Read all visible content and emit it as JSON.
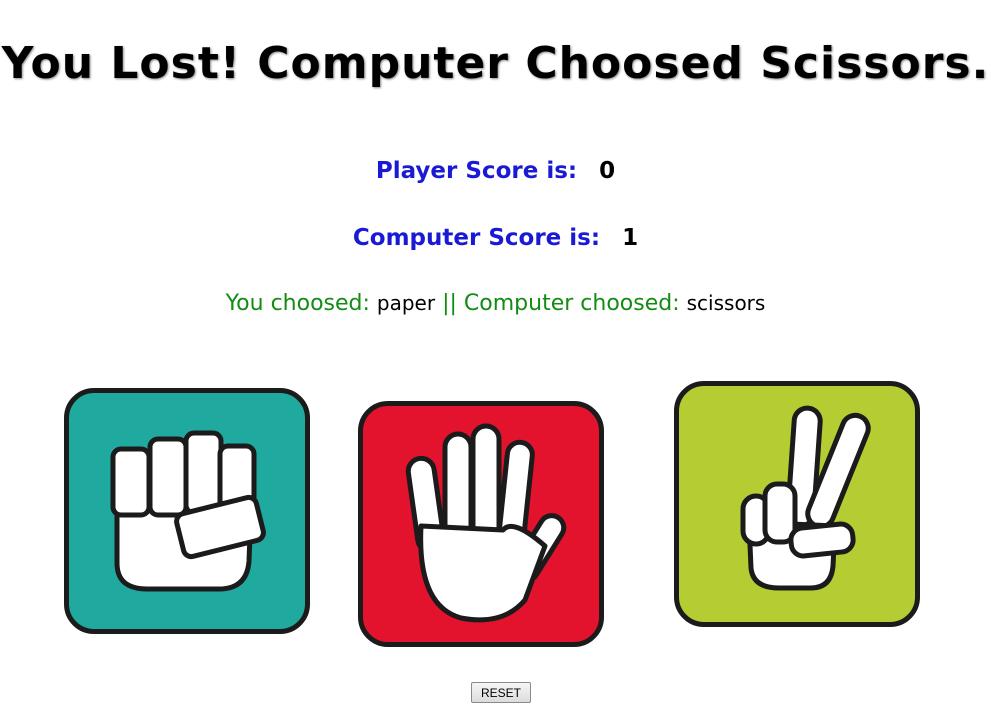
{
  "title": "You Lost! Computer Choosed Scissors.",
  "player_score": {
    "label": "Player Score is:",
    "value": "0"
  },
  "computer_score": {
    "label": "Computer Score is:",
    "value": "1"
  },
  "choices": {
    "you_label": "You choosed:",
    "you_value": "paper",
    "separator": "||",
    "computer_label": "Computer choosed:",
    "computer_value": "scissors"
  },
  "cards": [
    {
      "name": "rock",
      "icon": "fist-icon",
      "color": "#1fa99f"
    },
    {
      "name": "paper",
      "icon": "open-hand-icon",
      "color": "#e3132d"
    },
    {
      "name": "scissors",
      "icon": "peace-sign-icon",
      "color": "#b5cc32"
    }
  ],
  "reset_label": "RESET",
  "colors": {
    "label_blue": "#1a1ad6",
    "choice_green": "#148c14",
    "rock": "#1fa99f",
    "paper": "#e3132d",
    "scissors": "#b5cc32"
  }
}
